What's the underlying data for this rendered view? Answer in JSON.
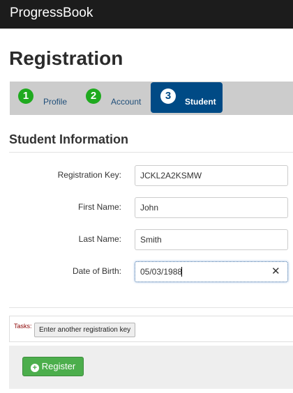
{
  "app": {
    "brand": "ProgressBook"
  },
  "page": {
    "title": "Registration"
  },
  "steps": [
    {
      "number": "1",
      "label": "Profile",
      "state": "complete"
    },
    {
      "number": "2",
      "label": "Account",
      "state": "complete"
    },
    {
      "number": "3",
      "label": "Student",
      "state": "active"
    }
  ],
  "section": {
    "title": "Student Information"
  },
  "form": {
    "registration_key": {
      "label": "Registration Key:",
      "value": "JCKL2A2KSMW"
    },
    "first_name": {
      "label": "First Name:",
      "value": "John"
    },
    "last_name": {
      "label": "Last Name:",
      "value": "Smith"
    },
    "date_of_birth": {
      "label": "Date of Birth:",
      "value": "05/03/1988",
      "clear_icon": "✕"
    }
  },
  "tasks": {
    "label": "Tasks:",
    "button": "Enter another registration key"
  },
  "actions": {
    "register": "Register",
    "register_icon": "plus-circle-icon"
  },
  "colors": {
    "topbar": "#1c1c1c",
    "step_complete": "#1faa1f",
    "step_active": "#004a85",
    "register_button": "#4cae4c"
  }
}
